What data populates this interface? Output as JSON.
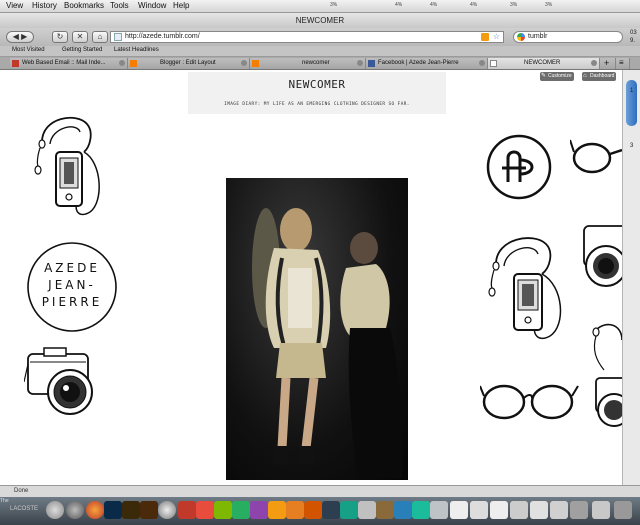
{
  "menubar": {
    "items": [
      "View",
      "History",
      "Bookmarks",
      "Tools",
      "Window",
      "Help"
    ],
    "status": [
      "3%",
      "4%",
      "4%",
      "4%",
      "3%",
      "3%"
    ]
  },
  "window": {
    "title": "NEWCOMER"
  },
  "toolbar": {
    "url": "http://azede.tumblr.com/",
    "search_value": "tumblr"
  },
  "bookmarks": {
    "items": [
      "Most Visited",
      "Getting Started",
      "Latest Headlines"
    ]
  },
  "tabs": [
    {
      "label": "Web Based Email :: Mail Inde...",
      "active": false
    },
    {
      "label": "Blogger : Edit Layout",
      "active": false
    },
    {
      "label": "newcomer",
      "active": false
    },
    {
      "label": "Facebook | Azede Jean-Pierre",
      "active": false
    },
    {
      "label": "NEWCOMER",
      "active": true
    }
  ],
  "page": {
    "customize_label": "Customize",
    "dashboard_label": "Dashboard",
    "blog_title": "NEWCOMER",
    "blog_description": "IMAGE DIARY: MY LIFE AS AN EMERGING CLOTHING DESIGNER SO FAR.",
    "logo_lines": [
      "AZEDE",
      "JEAN-",
      "PIERRE"
    ]
  },
  "status": {
    "text": "Done"
  },
  "dock": {
    "label_left": "The",
    "label_brand": "LACOSTE"
  },
  "right_edge": [
    "03",
    "9.",
    "1",
    "3"
  ],
  "colors": {
    "scroll_thumb": "#2d6cc0",
    "dock": "#3a424a",
    "tab_active": "#e4e4e4"
  }
}
